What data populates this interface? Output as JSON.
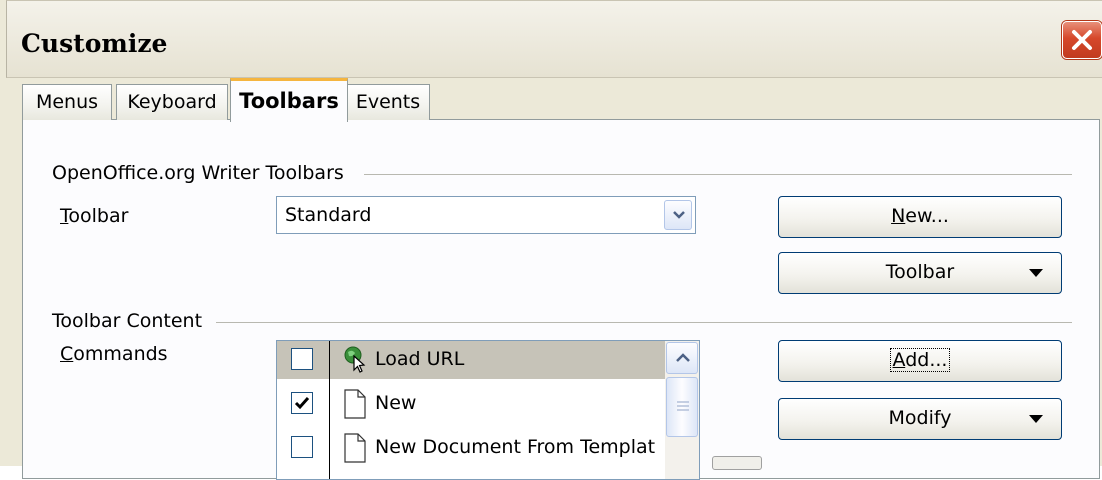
{
  "window": {
    "title": "Customize"
  },
  "tabs": [
    {
      "label": "Menus"
    },
    {
      "label": "Keyboard"
    },
    {
      "label": "Toolbars"
    },
    {
      "label": "Events"
    }
  ],
  "active_tab": "Toolbars",
  "toolbars_section": {
    "title": "OpenOffice.org Writer Toolbars",
    "toolbar_label_mnemonic": "T",
    "toolbar_label_rest": "oolbar",
    "toolbar_value": "Standard",
    "new_button_mnemonic": "N",
    "new_button_rest": "ew...",
    "toolbar_menu_button": "Toolbar"
  },
  "content_section": {
    "title": "Toolbar Content",
    "commands_label_mnemonic": "C",
    "commands_label_rest": "ommands",
    "add_button_mnemonic": "A",
    "add_button_rest": "dd...",
    "modify_button": "Modify",
    "commands": [
      {
        "label": "Load URL",
        "checked": false,
        "icon": "load-url-icon",
        "selected": true
      },
      {
        "label": "New",
        "checked": true,
        "icon": "new-document-icon",
        "selected": false
      },
      {
        "label": "New Document From Templat",
        "checked": false,
        "icon": "new-from-template-icon",
        "selected": false
      }
    ]
  },
  "colors": {
    "dialog_bg": "#ece9d8",
    "panel_bg": "#fcfcfe",
    "active_tab_accent": "#f5b53f",
    "close_button": "#d6482b",
    "selected_row": "#c6c3b8"
  }
}
